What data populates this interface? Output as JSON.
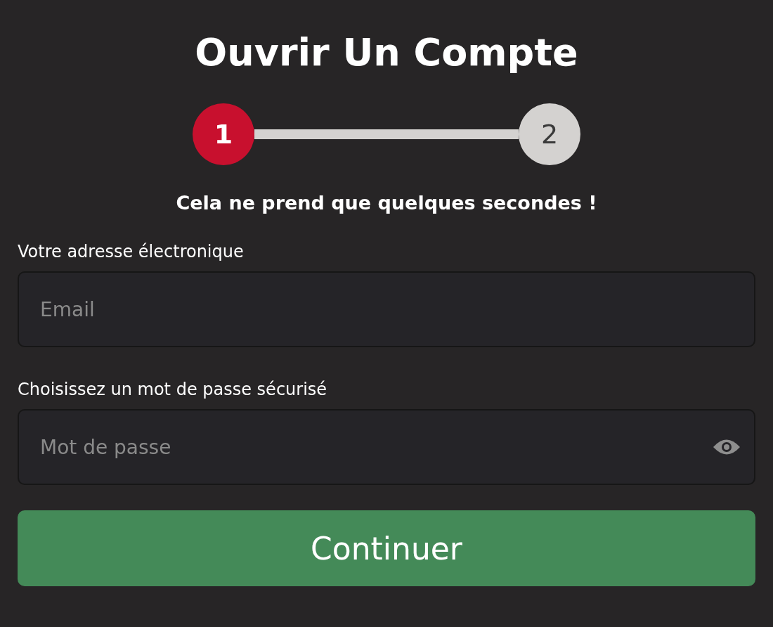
{
  "title": "Ouvrir Un Compte",
  "steps": [
    {
      "label": "1",
      "selected": true
    },
    {
      "label": "2",
      "selected": false
    }
  ],
  "subtitle": "Cela ne prend que quelques secondes !",
  "fields": [
    {
      "label": "Votre adresse électronique",
      "placeholder": "Email",
      "kind": "text"
    },
    {
      "label": "Choisissez un mot de passe sécurisé",
      "placeholder": "Mot de passe",
      "kind": "password"
    }
  ],
  "button": "Continuer"
}
